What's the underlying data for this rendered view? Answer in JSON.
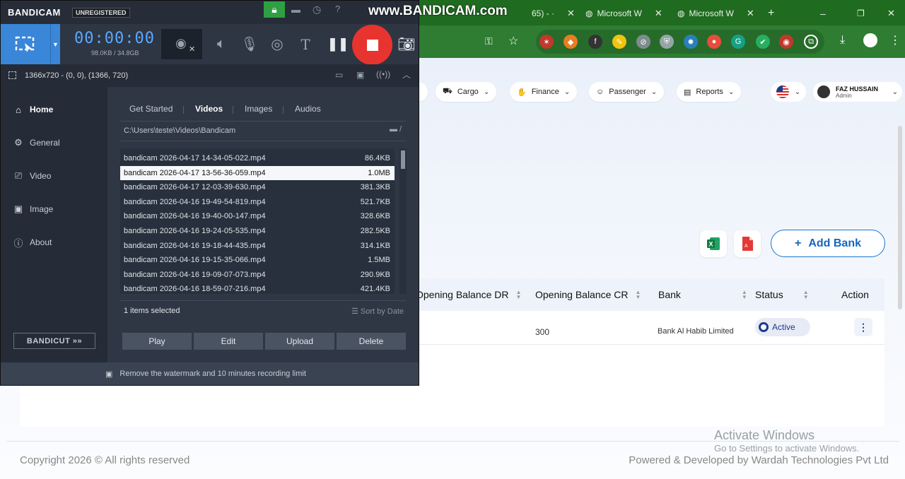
{
  "browser": {
    "tabs": [
      {
        "label": "65) - ·",
        "close": "✕"
      },
      {
        "label": "Microsoft W",
        "close": "✕"
      },
      {
        "label": "Microsoft W",
        "close": "✕"
      }
    ],
    "new_tab": "+",
    "window_controls": [
      "–",
      "❐",
      "✕"
    ],
    "watermark": "www.BANDICAM.com"
  },
  "app": {
    "nav": [
      {
        "label": "Cargo",
        "icon": "cargo-icon"
      },
      {
        "label": "Finance",
        "icon": "finance-icon"
      },
      {
        "label": "Passenger",
        "icon": "passenger-icon"
      },
      {
        "label": "Reports",
        "icon": "reports-icon"
      }
    ],
    "user": {
      "name": "FAZ HUSSAIN",
      "role": "Admin"
    },
    "add_bank_label": "Add Bank",
    "table": {
      "columns": [
        "Opening Balance DR",
        "Opening Balance CR",
        "Bank",
        "Status",
        "Action"
      ],
      "rows": [
        {
          "opening_cr": "300",
          "bank": "Bank Al Habib Limited",
          "status": "Active",
          "action": "⋮"
        }
      ]
    },
    "footer": {
      "copyright": "Copyright 2026 © All rights reserved",
      "powered": "Powered & Developed by Wardah Technologies Pvt Ltd"
    },
    "activate_windows": {
      "title": "Activate Windows",
      "subtitle": "Go to Settings to activate Windows."
    }
  },
  "bandicam": {
    "logo": "BANDICAM",
    "unregistered": "UNREGISTERED",
    "timer": "00:00:00",
    "sizes": "98.0KB / 34.8GB",
    "resolution": "1366x720 - (0, 0), (1366, 720)",
    "sidebar": [
      {
        "label": "Home",
        "icon": "home-icon"
      },
      {
        "label": "General",
        "icon": "gear-icon"
      },
      {
        "label": "Video",
        "icon": "video-icon"
      },
      {
        "label": "Image",
        "icon": "image-icon"
      },
      {
        "label": "About",
        "icon": "info-icon"
      }
    ],
    "bandicut": "BANDICUT »»",
    "tabs": [
      "Get Started",
      "Videos",
      "Images",
      "Audios"
    ],
    "path": "C:\\Users\\teste\\Videos\\Bandicam",
    "files": [
      {
        "name": "bandicam 2026-04-17 14-34-05-022.mp4",
        "size": "86.4KB"
      },
      {
        "name": "bandicam 2026-04-17 13-56-36-059.mp4",
        "size": "1.0MB"
      },
      {
        "name": "bandicam 2026-04-17 12-03-39-630.mp4",
        "size": "381.3KB"
      },
      {
        "name": "bandicam 2026-04-16 19-49-54-819.mp4",
        "size": "521.7KB"
      },
      {
        "name": "bandicam 2026-04-16 19-40-00-147.mp4",
        "size": "328.6KB"
      },
      {
        "name": "bandicam 2026-04-16 19-24-05-535.mp4",
        "size": "282.5KB"
      },
      {
        "name": "bandicam 2026-04-16 19-18-44-435.mp4",
        "size": "314.1KB"
      },
      {
        "name": "bandicam 2026-04-16 19-15-35-066.mp4",
        "size": "1.5MB"
      },
      {
        "name": "bandicam 2026-04-16 19-09-07-073.mp4",
        "size": "290.9KB"
      },
      {
        "name": "bandicam 2026-04-16 18-59-07-216.mp4",
        "size": "421.4KB"
      }
    ],
    "selected_index": 1,
    "selected_count": "1 items selected",
    "sort_by": "Sort by Date",
    "actions": [
      "Play",
      "Edit",
      "Upload",
      "Delete"
    ],
    "status_message": "Remove the watermark and 10 minutes recording limit"
  },
  "colors": {
    "bandicam_accent": "#3a86d8",
    "record_red": "#e8342e",
    "browser_green": "#2e7d32",
    "link_blue": "#1565c0"
  }
}
